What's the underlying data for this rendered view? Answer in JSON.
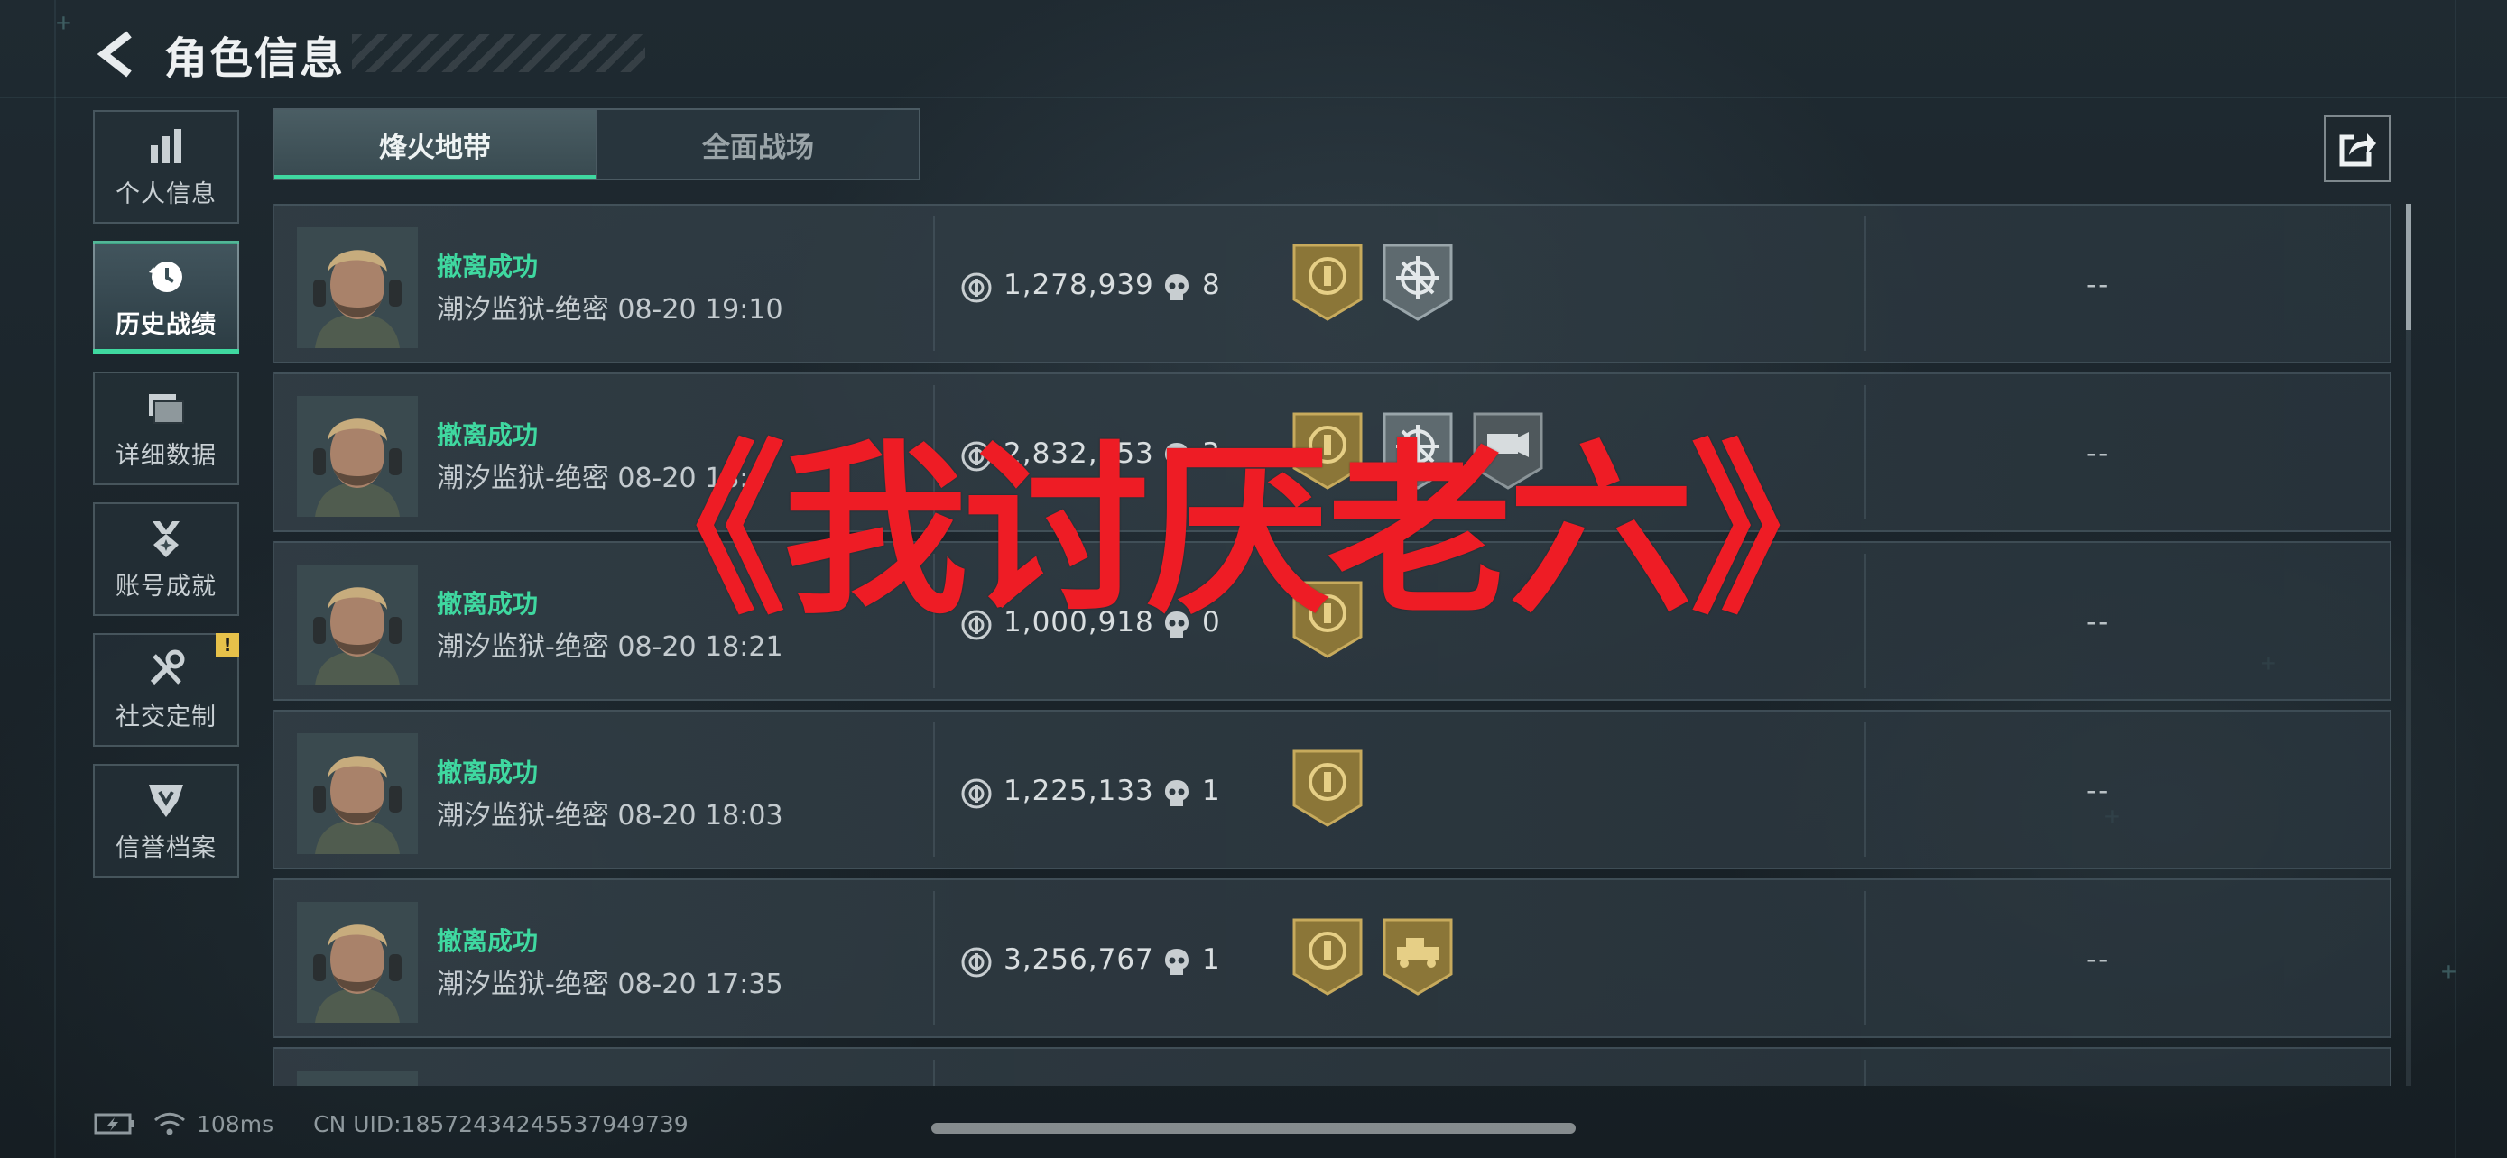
{
  "header": {
    "title": "角色信息"
  },
  "sidebar": {
    "items": [
      {
        "label": "个人信息",
        "icon": "bar-chart-icon",
        "active": false
      },
      {
        "label": "历史战绩",
        "icon": "history-clock-icon",
        "active": true
      },
      {
        "label": "详细数据",
        "icon": "folder-icon",
        "active": false
      },
      {
        "label": "账号成就",
        "icon": "medal-icon",
        "active": false
      },
      {
        "label": "社交定制",
        "icon": "tools-icon",
        "active": false,
        "badge": "!"
      },
      {
        "label": "信誉档案",
        "icon": "emblem-icon",
        "active": false
      }
    ]
  },
  "tabs": [
    {
      "label": "烽火地带",
      "active": true
    },
    {
      "label": "全面战场",
      "active": false
    }
  ],
  "share": {
    "icon": "share-icon"
  },
  "records": [
    {
      "result": "撤离成功",
      "map_time": "潮汐监狱-绝密 08-20 19:10",
      "value": "1,278,939",
      "kills": "8",
      "badges": [
        "gold-emblem-badge",
        "crosshair-badge"
      ],
      "extra": "--"
    },
    {
      "result": "撤离成功",
      "map_time": "潮汐监狱-绝密 08-20 18:4",
      "value": "2,832,353",
      "kills": "3",
      "badges": [
        "gold-emblem-badge",
        "crosshair-badge",
        "gear-badge"
      ],
      "extra": "--"
    },
    {
      "result": "撤离成功",
      "map_time": "潮汐监狱-绝密 08-20 18:21",
      "value": "1,000,918",
      "kills": "0",
      "badges": [
        "gold-emblem-badge"
      ],
      "extra": "--"
    },
    {
      "result": "撤离成功",
      "map_time": "潮汐监狱-绝密 08-20 18:03",
      "value": "1,225,133",
      "kills": "1",
      "badges": [
        "gold-emblem-badge"
      ],
      "extra": "--"
    },
    {
      "result": "撤离成功",
      "map_time": "潮汐监狱-绝密 08-20 17:35",
      "value": "3,256,767",
      "kills": "1",
      "badges": [
        "gold-emblem-badge",
        "gold-vehicle-badge"
      ],
      "extra": "--"
    }
  ],
  "footer": {
    "ping": "108ms",
    "uid": "CN UID:18572434245537949739"
  },
  "overlay": {
    "caption": "《我讨厌老六》"
  },
  "colors": {
    "accent": "#3fd8a0",
    "overlay": "#ee1c25",
    "badge_gold": "#b89a4e",
    "badge_silver": "#7f8b90"
  }
}
